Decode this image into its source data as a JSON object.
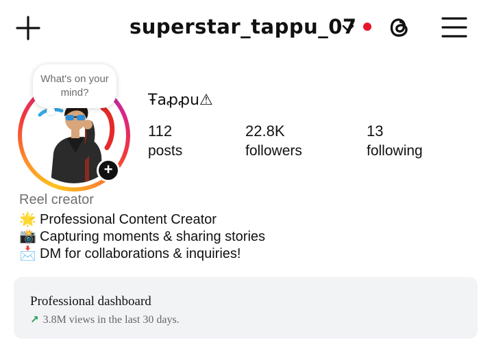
{
  "header": {
    "username": "superstar_tappu_07",
    "icons": {
      "create": "plus-icon",
      "switch_account": "chevron-down-icon",
      "threads": "threads-icon",
      "menu": "hamburger-menu-icon"
    },
    "notification_dot_color": "#e5152c"
  },
  "profile": {
    "display_name": "Ŧaꝓꝓu⚠",
    "note_prompt": "What's on your mind?",
    "story_ring_colors": [
      "#fdc41b",
      "#fb8a2c",
      "#f0373c",
      "#d8258a",
      "#a92fc9"
    ],
    "stats": {
      "posts": {
        "value": "112",
        "label": "posts"
      },
      "followers": {
        "value": "22.8K",
        "label": "followers"
      },
      "following": {
        "value": "13",
        "label": "following"
      }
    }
  },
  "bio": {
    "category": "Reel creator",
    "lines": [
      {
        "emoji": "🌟",
        "text": "Professional Content Creator"
      },
      {
        "emoji": "📸",
        "text": "Capturing moments & sharing stories"
      },
      {
        "emoji": "📩",
        "text": "DM for collaborations & inquiries!"
      }
    ]
  },
  "dashboard": {
    "title": "Professional dashboard",
    "subtitle": "3.8M views in the last 30 days.",
    "trend_icon": "trending-up-icon",
    "trend_color": "#1e9b4d"
  }
}
